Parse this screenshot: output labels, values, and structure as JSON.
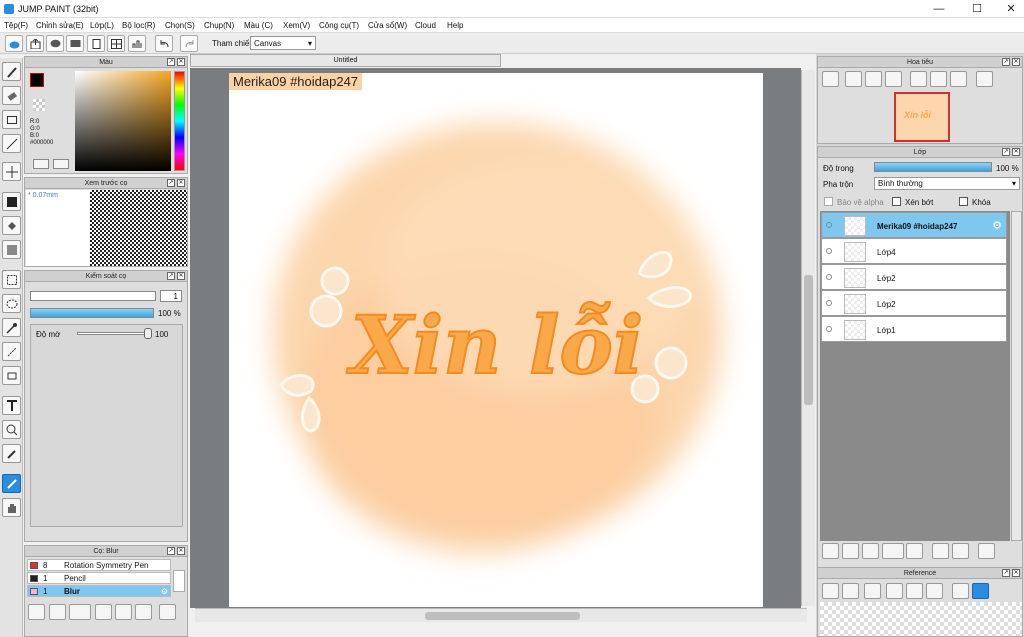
{
  "app": {
    "title": "JUMP PAINT (32bit)"
  },
  "menu": [
    "Tệp(F)",
    "Chỉnh sửa(E)",
    "Lớp(L)",
    "Bộ lọc(R)",
    "Chọn(S)",
    "Chụp(N)",
    "Màu (C)",
    "Xem(V)",
    "Công cụ(T)",
    "Cửa sổ(W)",
    "Cloud",
    "Help"
  ],
  "toolbar": {
    "reference_label": "Tham chiếu",
    "reference_value": "Canvas"
  },
  "color_panel": {
    "title": "Màu",
    "r": "R:0",
    "g": "G:0",
    "b": "B:0",
    "hex": "#000000",
    "foreground": "#000000",
    "accent": "#2a8de0"
  },
  "brush_preview": {
    "title": "Xem trước cọ",
    "size": "0.07mm"
  },
  "brush_control": {
    "title": "Kiểm soát cọ",
    "size_value": "1",
    "percent": "100 %",
    "opacity_label": "Độ mờ",
    "opacity_value": "100",
    "opacity": 1.0
  },
  "document": {
    "tab": "Untitled"
  },
  "canvas": {
    "watermark": "Merika09 #hoidap247",
    "art_text": "Xin lỗi",
    "wash_color": "#fcd2a5",
    "text_color": "#f9a94a"
  },
  "navigator": {
    "title": "Hoa tiêu"
  },
  "layers": {
    "title": "Lớp",
    "opacity_label": "Độ trong",
    "opacity_value": "100 %",
    "blend_label": "Pha trộn",
    "blend_value": "Bình thường",
    "protect_alpha": "Bảo vệ alpha",
    "clip": "Xén bớt",
    "lock": "Khóa",
    "items": [
      {
        "name": "Merika09  #hoidap247",
        "selected": true
      },
      {
        "name": "Lớp4",
        "selected": false
      },
      {
        "name": "Lớp2",
        "selected": false
      },
      {
        "name": "Lớp2",
        "selected": false
      },
      {
        "name": "Lớp1",
        "selected": false
      }
    ]
  },
  "reference": {
    "title": "Reference"
  },
  "brushes": {
    "title": "Cọ: Blur",
    "items": [
      {
        "size": "8",
        "name": "Rotation Symmetry Pen",
        "color": "#e53030",
        "selected": false
      },
      {
        "size": "1",
        "name": "Pencil",
        "color": "#222222",
        "selected": false
      },
      {
        "size": "1",
        "name": "Blur",
        "color": "#f2b0e6",
        "selected": true
      }
    ]
  }
}
